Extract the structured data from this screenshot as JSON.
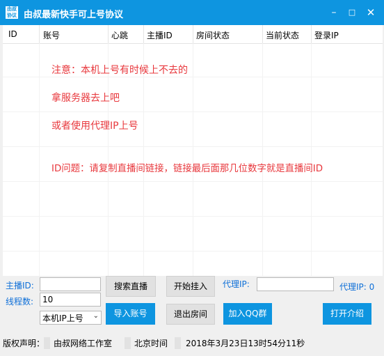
{
  "window": {
    "title": "由叔最新快手可上号协议",
    "icon_text": "由叔 协议",
    "minimize_icon": "minimize-icon",
    "maximize_icon": "maximize-icon",
    "close_icon": "close-icon",
    "accent_color": "#0e95e0"
  },
  "table": {
    "columns": [
      "ID",
      "账号",
      "心跳",
      "主播ID",
      "房间状态",
      "当前状态",
      "登录IP"
    ]
  },
  "notices": [
    "注意：本机上号有时候上不去的",
    "拿服务器去上吧",
    "或者使用代理IP上号",
    "ID问题：请复制直播间链接，链接最后面那几位数字就是直播间ID"
  ],
  "form": {
    "anchor_label": "主播ID:",
    "anchor_value": "",
    "threads_label": "线程数:",
    "threads_value": "10",
    "mode_value": "本机IP上号",
    "proxy_label": "代理IP:",
    "proxy_value": "",
    "proxy_count": "代理IP: 0"
  },
  "buttons": {
    "search": "搜索直播",
    "start": "开始挂入",
    "import": "导入账号",
    "exit_room": "退出房间",
    "join_qq": "加入QQ群",
    "open_intro": "打开介绍"
  },
  "status": {
    "copyright_label": "版权声明：",
    "studio": "由叔网络工作室",
    "time_label": "北京时间",
    "datetime": "2018年3月23日13时54分11秒"
  }
}
